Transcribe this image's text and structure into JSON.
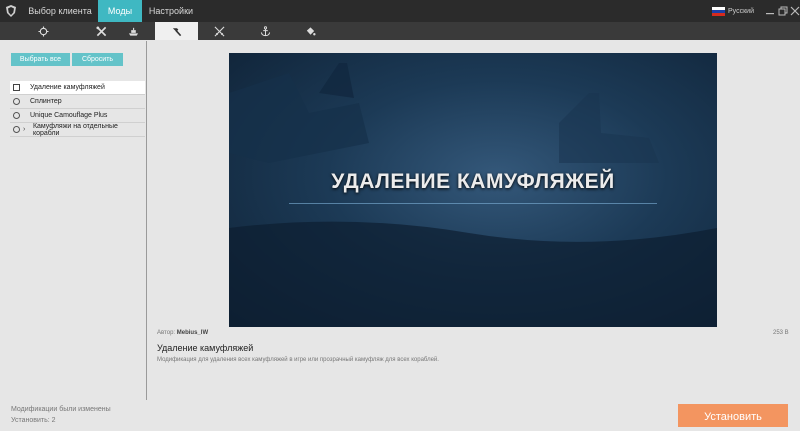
{
  "menu": {
    "tabs": [
      {
        "label": "Выбор клиента"
      },
      {
        "label": "Моды"
      },
      {
        "label": "Настройки"
      }
    ]
  },
  "language": {
    "label": "Русский"
  },
  "category_tabs": [
    {
      "icon": "crosshair-icon"
    },
    {
      "icon": "crossed-tools-icon"
    },
    {
      "icon": "ship-icon"
    },
    {
      "icon": "hammer-icon"
    },
    {
      "icon": "crossed-swords-icon"
    },
    {
      "icon": "anchor-icon"
    },
    {
      "icon": "paint-bucket-icon"
    }
  ],
  "buttons": {
    "select_all": "Выбрать все",
    "reset": "Сбросить"
  },
  "mods": [
    {
      "label": "Удаление камуфляжей",
      "control": "checkbox",
      "selected": true
    },
    {
      "label": "Сплинтер",
      "control": "radio"
    },
    {
      "label": "Unique Camouflage Plus",
      "control": "radio"
    },
    {
      "label": "Камуфляжи на отдельные корабли",
      "control": "radio",
      "expandable": true
    }
  ],
  "preview": {
    "title": "УДАЛЕНИЕ КАМУФЛЯЖЕЙ"
  },
  "details": {
    "author_label": "Автор:",
    "author": "Mebius_lW",
    "size": "253 B",
    "title": "Удаление камуфляжей",
    "description": "Модификация для удаления всех камуфляжей в игре или прозрачный камуфляж для всех кораблей."
  },
  "status": {
    "changed": "Модификации были изменены",
    "install_count": "Установить: 2"
  },
  "install_button": "Установить",
  "colors": {
    "accent": "#3fb8c2",
    "install": "#f39560",
    "topbar": "#2b2b2b"
  }
}
